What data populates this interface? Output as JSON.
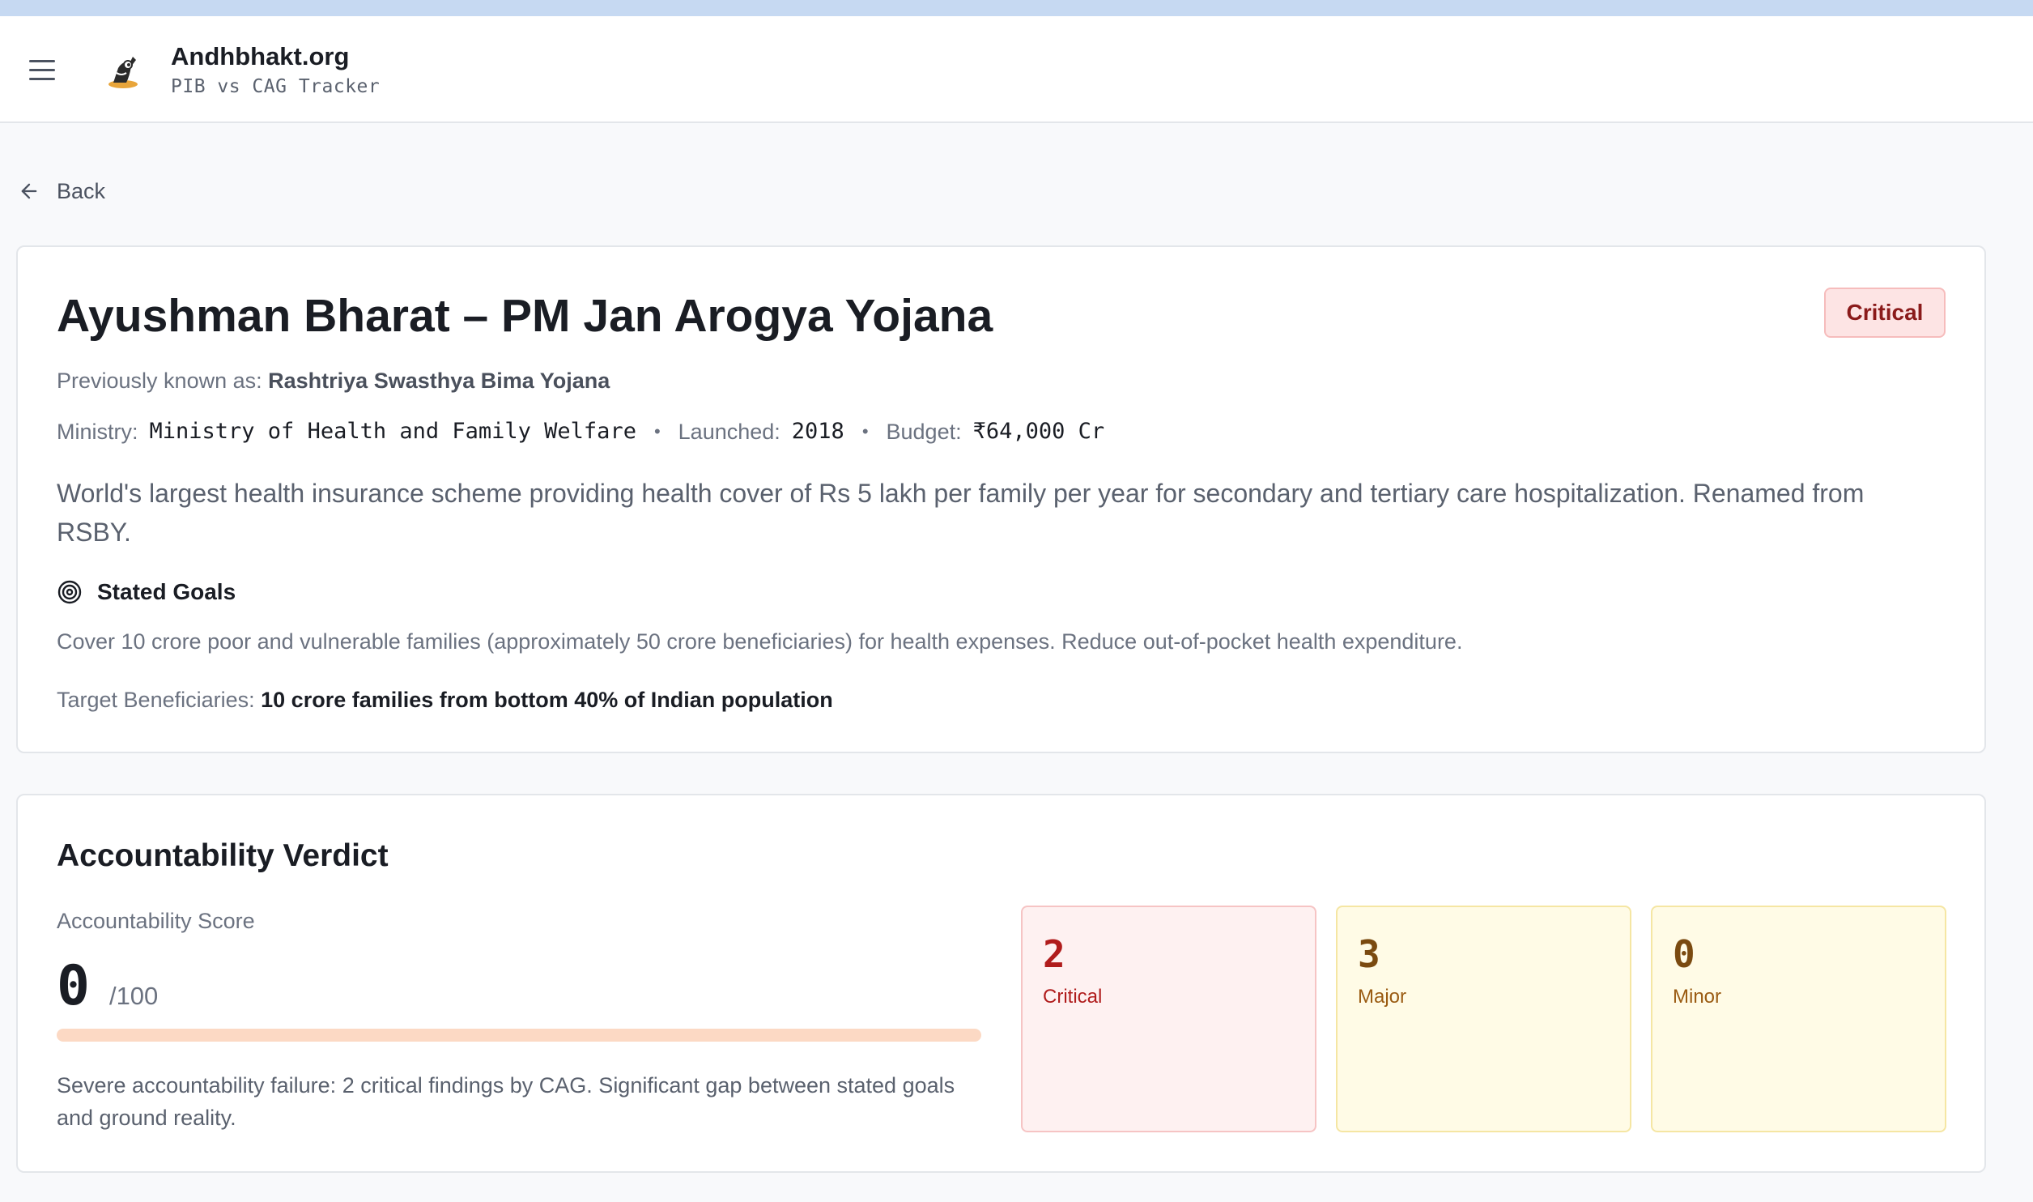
{
  "header": {
    "brand_name": "Andhbhakt.org",
    "brand_subtitle": "PIB vs CAG Tracker",
    "menu_icon": "hamburger-icon",
    "logo_icon": "mascot-logo"
  },
  "nav": {
    "back_label": "Back",
    "back_icon": "arrow-left-icon"
  },
  "scheme": {
    "title": "Ayushman Bharat – PM Jan Arogya Yojana",
    "severity_badge": "Critical",
    "previously_known_label": "Previously known as:",
    "previously_known_value": "Rashtriya Swasthya Bima Yojana",
    "ministry_label": "Ministry:",
    "ministry_value": "Ministry of Health and Family Welfare",
    "launched_label": "Launched:",
    "launched_value": "2018",
    "budget_label": "Budget:",
    "budget_value": "₹64,000 Cr",
    "separator": "•",
    "description": "World's largest health insurance scheme providing health cover of Rs 5 lakh per family per year for secondary and tertiary care hospitalization. Renamed from RSBY.",
    "goals_heading": "Stated Goals",
    "goals_icon": "target-icon",
    "goals_text": "Cover 10 crore poor and vulnerable families (approximately 50 crore beneficiaries) for health expenses. Reduce out-of-pocket health expenditure.",
    "target_label": "Target Beneficiaries:",
    "target_value": "10 crore families from bottom 40% of Indian population"
  },
  "verdict": {
    "title": "Accountability Verdict",
    "score_label": "Accountability Score",
    "score_value": "0",
    "score_max": "/100",
    "score_fraction": 0,
    "summary": "Severe accountability failure: 2 critical findings by CAG. Significant gap between stated goals and ground reality.",
    "counts": {
      "critical": {
        "value": "2",
        "label": "Critical"
      },
      "major": {
        "value": "3",
        "label": "Major"
      },
      "minor": {
        "value": "0",
        "label": "Minor"
      }
    }
  },
  "colors": {
    "critical_bg": "#fef1f1",
    "critical_text": "#b01c1c",
    "warning_bg": "#fffbe6",
    "warning_text": "#9a5b12",
    "score_track": "#fcd9c4"
  }
}
